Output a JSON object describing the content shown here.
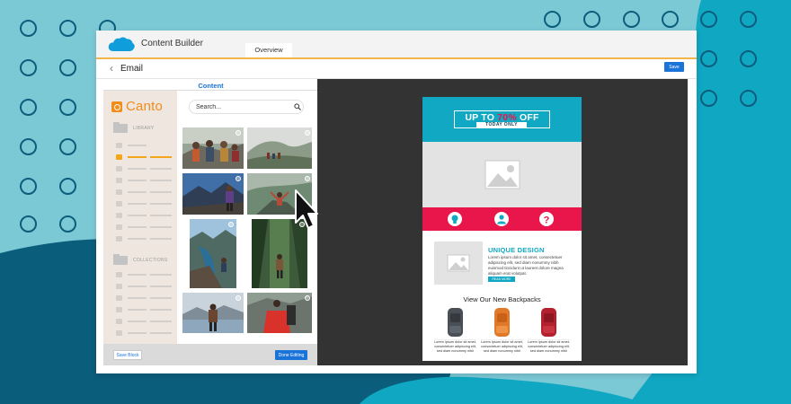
{
  "app": {
    "title": "Content Builder",
    "tab_overview": "Overview",
    "page_title": "Email",
    "save_label": "Save"
  },
  "left_panel": {
    "content_tab": "Content",
    "canto": {
      "logo_text": "Canto",
      "library_label": "LIBRARY",
      "collections_label": "COLLECTIONS"
    },
    "search": {
      "placeholder": "Search..."
    },
    "footer": {
      "save_block_label": "Save Block",
      "done_label": "Done Editing"
    }
  },
  "email": {
    "promo": {
      "prefix": "UP TO",
      "highlight": "70%",
      "suffix": "OFF",
      "sub": "TODAY ONLY"
    },
    "feature": {
      "title": "UNIQUE DESIGN",
      "body": "Lorem ipsum dolor sit amet, consectetuer adipiscing elit, sed diam nonummy nibh euismod tincidunt ut laoreet dolore magna aliquam erat volutpat.",
      "button": "READ MORE"
    },
    "products_heading": "View Our New Backpacks",
    "product_texts": [
      "Lorem ipsum dolor sit amet, consectetuer adipiscing elit, sed diam nonummy nibh",
      "Lorem ipsum dolor sit amet, consectetuer adipiscing elit, sed diam nonummy nibh",
      "Lorem ipsum dolor sit amet, consectetuer adipiscing elit, sed diam nonummy nibh"
    ]
  },
  "colors": {
    "background": "#7cc9d6",
    "dark_teal": "#0b5d7c",
    "brand_orange": "#f28c1a",
    "accent_blue": "#1a73d9",
    "email_teal": "#10a8c3",
    "email_pink": "#e8164a"
  },
  "icons": [
    "salesforce-cloud-icon",
    "back-arrow-icon",
    "folder-icon",
    "search-icon",
    "image-placeholder-icon",
    "lightbulb-icon",
    "user-icon",
    "question-icon",
    "cursor-arrow-icon"
  ]
}
